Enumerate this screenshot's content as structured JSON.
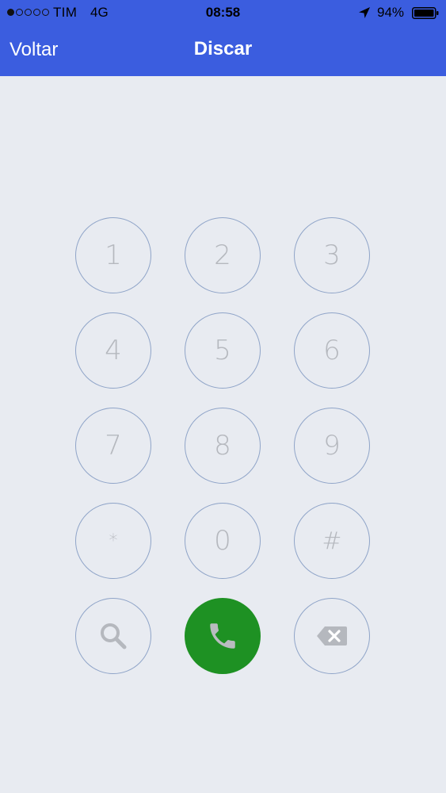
{
  "status_bar": {
    "carrier": "TIM",
    "network": "4G",
    "time": "08:58",
    "battery_percent": "94%",
    "signal_bars_filled": 1,
    "signal_bars_total": 5
  },
  "nav": {
    "back_label": "Voltar",
    "title": "Discar"
  },
  "keypad": {
    "keys": [
      "1",
      "2",
      "3",
      "4",
      "5",
      "6",
      "7",
      "8",
      "9",
      "*",
      "0",
      "#"
    ],
    "bottom_row": [
      "search-icon",
      "phone-icon",
      "backspace-icon"
    ]
  },
  "colors": {
    "nav_background": "#3b5ddf",
    "page_background": "#e8ebf1",
    "key_border": "#8fa4c8",
    "key_text": "#b5b8be",
    "call_button": "#1e9123"
  }
}
